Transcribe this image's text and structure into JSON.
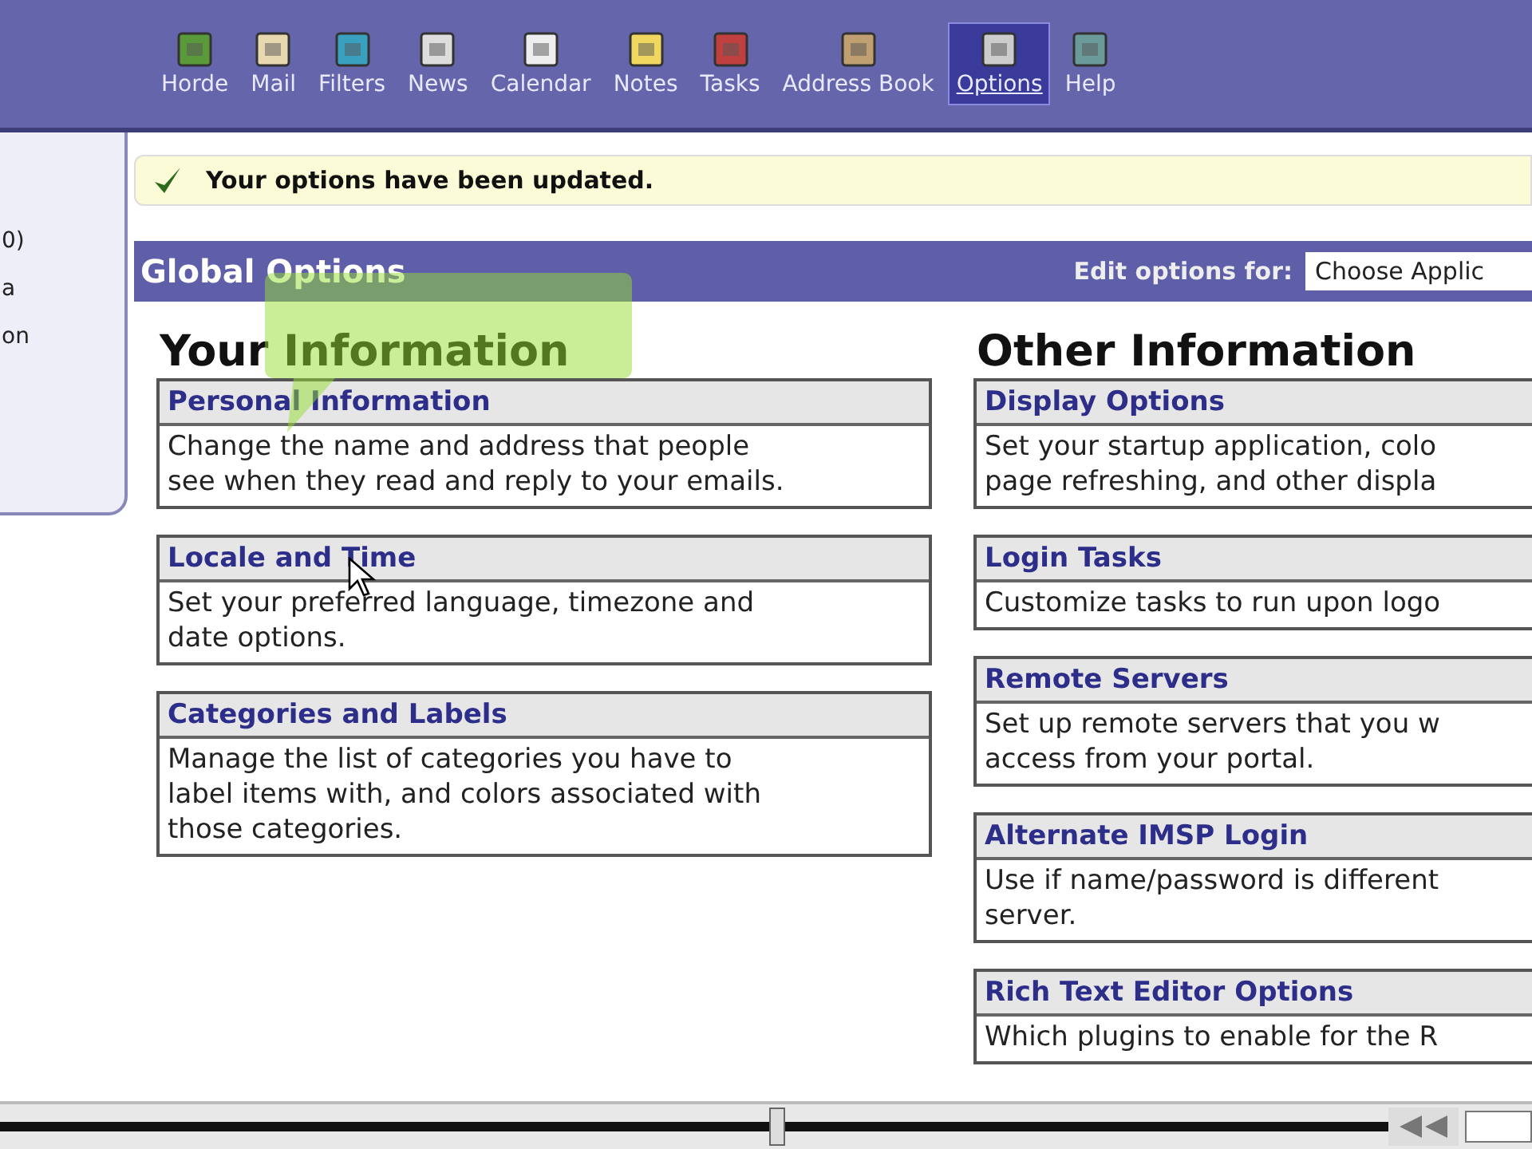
{
  "nav": [
    {
      "label": "Horde",
      "selected": false
    },
    {
      "label": "Mail",
      "selected": false
    },
    {
      "label": "Filters",
      "selected": false
    },
    {
      "label": "News",
      "selected": false
    },
    {
      "label": "Calendar",
      "selected": false
    },
    {
      "label": "Notes",
      "selected": false
    },
    {
      "label": "Tasks",
      "selected": false
    },
    {
      "label": "Address Book",
      "selected": false
    },
    {
      "label": "Options",
      "selected": true
    },
    {
      "label": "Help",
      "selected": false
    }
  ],
  "sidebar": {
    "items": [
      "0)",
      "a",
      "on"
    ]
  },
  "notification": "Your options have been updated.",
  "header": {
    "title": "Global Options",
    "edit_label": "Edit options for:",
    "select_value": "Choose Applic"
  },
  "columns": [
    {
      "title": "Your Information",
      "sections": [
        {
          "title": "Personal Information",
          "lines": [
            "Change the name and address that people",
            "see when they read and reply to your emails."
          ]
        },
        {
          "title": "Locale and Time",
          "lines": [
            "Set your preferred language, timezone and",
            "date options."
          ]
        },
        {
          "title": "Categories and Labels",
          "lines": [
            "Manage the list of categories you have to",
            "label items with, and colors associated with",
            "those categories."
          ]
        }
      ]
    },
    {
      "title": "Other Information",
      "sections": [
        {
          "title": "Display Options",
          "lines": [
            "Set your startup application, colo",
            "page refreshing, and other displa"
          ]
        },
        {
          "title": "Login Tasks",
          "lines": [
            "Customize tasks to run upon logo"
          ]
        },
        {
          "title": "Remote Servers",
          "lines": [
            "Set up remote servers that you w",
            "access from your portal."
          ]
        },
        {
          "title": "Alternate IMSP Login",
          "lines": [
            "Use if name/password is different",
            "server."
          ]
        },
        {
          "title": "Rich Text Editor Options",
          "lines": [
            "Which plugins to enable for the R"
          ]
        }
      ]
    }
  ],
  "tooltip": {
    "kind": "callout"
  },
  "player": {
    "level": 0.56
  }
}
